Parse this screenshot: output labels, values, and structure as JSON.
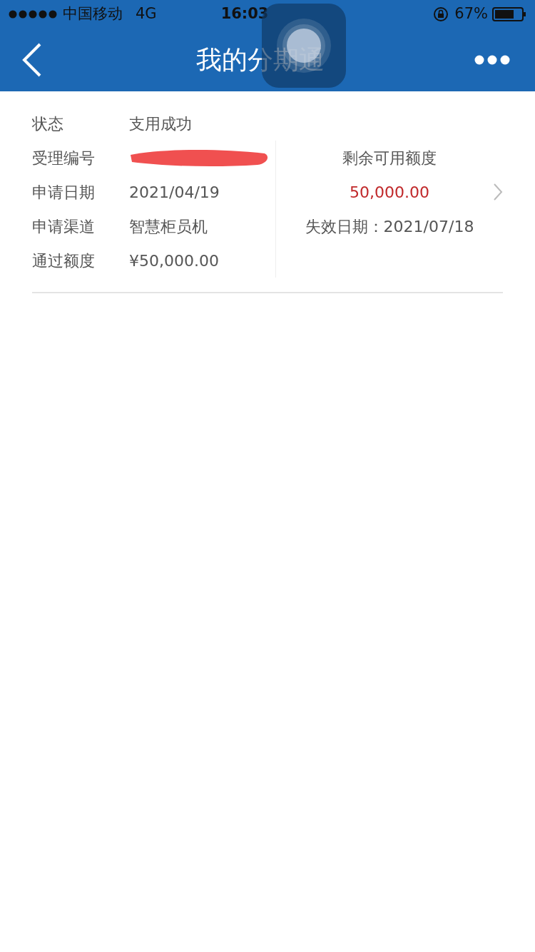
{
  "status_bar": {
    "carrier": "中国移动",
    "network": "4G",
    "time": "16:03",
    "battery": "67%"
  },
  "nav": {
    "title": "我的分期通"
  },
  "details": [
    {
      "label": "状态",
      "value": "支用成功",
      "kind": "text"
    },
    {
      "label": "受理编号",
      "kind": "redacted"
    },
    {
      "label": "申请日期",
      "value": "2021/04/19",
      "kind": "text"
    },
    {
      "label": "申请渠道",
      "value": "智慧柜员机",
      "kind": "text"
    },
    {
      "label": "通过额度",
      "value": "¥50,000.00",
      "kind": "text"
    }
  ],
  "credit": {
    "label": "剩余可用额度",
    "amount": "50,000.00",
    "expiry": "失效日期：2021/07/18"
  }
}
